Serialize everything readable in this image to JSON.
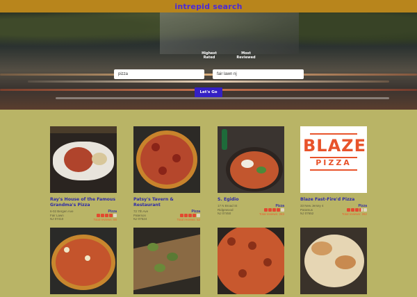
{
  "app": {
    "brand": "intrepid search"
  },
  "search": {
    "sort_labels": [
      "Highest Rated",
      "Most Reviewed"
    ],
    "term_value": "pizza",
    "location_value": "fair lawn nj",
    "submit_label": "Let's Go"
  },
  "colors": {
    "topbar": "#b8851c",
    "brand": "#4a2ad8",
    "page_bg": "#b9b466",
    "button": "#3420c4",
    "star_on": "#e24a30",
    "accent_link": "#2d2aa8"
  },
  "results": [
    {
      "name": "Ray's House of the Famous Grandma's Pizza",
      "address": [
        "6-02 Bergen Ave",
        "Fair Lawn",
        "NJ 07410"
      ],
      "category": "Pizza",
      "rating": 4,
      "reviews_label": "Total reviews: 88"
    },
    {
      "name": "Patsy's Tavern & Restaurant",
      "address": [
        "72 7th Ave",
        "Paterson",
        "NJ 07524"
      ],
      "category": "Pizza",
      "rating": 4,
      "reviews_label": "Total reviews: 52"
    },
    {
      "name": "S. Egidio",
      "address": [
        "17 N Broad St",
        "Ridgewood",
        "NJ 07450"
      ],
      "category": "Pizza",
      "rating": 4,
      "reviews_label": "Total reviews: 283"
    },
    {
      "name": "Blaze Fast-Fire'd Pizza",
      "address": [
        "33 New Jersey 4",
        "Paramus",
        "NJ 07652"
      ],
      "category": "Pizza",
      "rating": 3.5,
      "reviews_label": "Total reviews: 282"
    },
    {
      "name": "",
      "address": [],
      "category": "",
      "rating": 0,
      "reviews_label": ""
    },
    {
      "name": "",
      "address": [],
      "category": "",
      "rating": 0,
      "reviews_label": ""
    },
    {
      "name": "",
      "address": [],
      "category": "",
      "rating": 0,
      "reviews_label": ""
    },
    {
      "name": "",
      "address": [],
      "category": "",
      "rating": 0,
      "reviews_label": ""
    }
  ],
  "blaze_logo": {
    "word": "BLAZE",
    "sub": "PIZZA"
  }
}
